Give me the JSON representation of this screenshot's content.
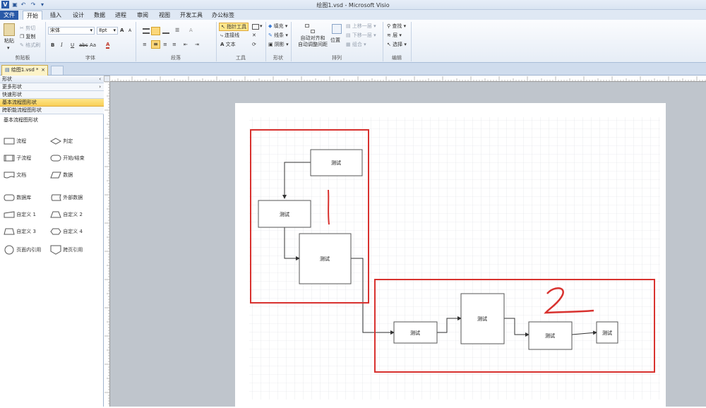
{
  "app": {
    "window_title": "绘图1.vsd - Microsoft Visio",
    "quick_access": [
      "save-icon",
      "undo-icon",
      "redo-icon",
      "customize-icon"
    ]
  },
  "tabs": [
    {
      "label": "文件"
    },
    {
      "label": "开始"
    },
    {
      "label": "插入"
    },
    {
      "label": "设计"
    },
    {
      "label": "数据"
    },
    {
      "label": "进程"
    },
    {
      "label": "审阅"
    },
    {
      "label": "视图"
    },
    {
      "label": "开发工具"
    },
    {
      "label": "办公标签"
    }
  ],
  "ribbon": {
    "clipboard": {
      "label": "剪贴板",
      "paste": "粘贴",
      "cut": "剪切",
      "copy": "复制",
      "format_painter": "格式刷"
    },
    "font": {
      "label": "字体",
      "font_name": "宋体",
      "font_size": "8pt",
      "grow": "A",
      "shrink": "A",
      "bold": "B",
      "italic": "I",
      "underline": "U",
      "strike": "abc",
      "case": "Aa",
      "color": "A"
    },
    "paragraph": {
      "label": "段落",
      "tstyle": "A"
    },
    "tools": {
      "label": "工具",
      "pointer": "指针工具",
      "connector": "连接线",
      "text": "文本"
    },
    "shape": {
      "label": "形状",
      "fill": "填充",
      "line": "线条",
      "shadow": "阴影"
    },
    "arrange": {
      "label": "排列",
      "auto_align": "自动对齐和\n自动调整间距",
      "position": "位置",
      "bring_forward": "上移一层",
      "send_backward": "下移一层",
      "group": "组合"
    },
    "editing": {
      "label": "编辑",
      "find": "查找",
      "layers": "层",
      "select": "选择"
    }
  },
  "document_tab": {
    "name": "绘图1.vsd *",
    "close": "×"
  },
  "shapes_pane": {
    "header": "形状",
    "more_shapes": "更多形状",
    "quick_shapes": "快速形状",
    "stencils": [
      "基本流程图形状",
      "跨职能流程图形状"
    ],
    "selected_stencil": "基本流程图形状",
    "section_title": "基本流程图形状",
    "items": [
      {
        "label": "流程",
        "icon": "process-shape-icon"
      },
      {
        "label": "判定",
        "icon": "decision-shape-icon"
      },
      {
        "label": "子流程",
        "icon": "subprocess-shape-icon"
      },
      {
        "label": "开始/结束",
        "icon": "start-end-shape-icon"
      },
      {
        "label": "文档",
        "icon": "document-shape-icon"
      },
      {
        "label": "数据",
        "icon": "data-shape-icon"
      },
      {
        "label": "数据库",
        "icon": "database-shape-icon"
      },
      {
        "label": "外部数据",
        "icon": "external-data-shape-icon"
      },
      {
        "label": "自定义 1",
        "icon": "custom1-shape-icon"
      },
      {
        "label": "自定义 2",
        "icon": "custom2-shape-icon"
      },
      {
        "label": "自定义 3",
        "icon": "custom3-shape-icon"
      },
      {
        "label": "自定义 4",
        "icon": "custom4-shape-icon"
      },
      {
        "label": "页面内引用",
        "icon": "on-page-ref-shape-icon"
      },
      {
        "label": "跨页引用",
        "icon": "off-page-ref-shape-icon"
      }
    ]
  },
  "drawing": {
    "shape_text": "测试",
    "annotation_1": "1",
    "annotation_2": "2",
    "highlight_color": "#d8322f"
  },
  "colors": {
    "accent": "#2a5aa8",
    "selected_tab": "#fde68a",
    "canvas_bg": "#bfc5cc"
  }
}
